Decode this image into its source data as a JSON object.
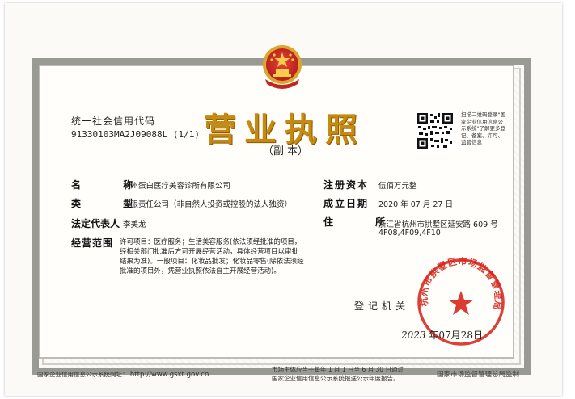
{
  "document": {
    "title": "营业执照",
    "subtitle": "（副 本）",
    "credit_code_label": "统一社会信用代码",
    "credit_code": "91330103MA2J09088L (1/1)",
    "qr_caption": "扫描二维码登录\"国家企业信用信息公示系统\"了解更多登记、备案、许可、监管信息",
    "fields": {
      "name_label": "名 称",
      "name": "杭州蛋白医疗美容诊所有限公司",
      "type_label": "类 型",
      "type": "有限责任公司（非自然人投资或控股的法人独资）",
      "legal_rep_label": "法定代表人",
      "legal_rep": "李美龙",
      "scope_label": "经营范围",
      "scope": "许可项目：医疗服务；生活美容服务(依法须经批准的项目，经相关部门批准后方可开展经营活动，具体经营项目以审批结果为准)。一般项目：化妆品批发；化妆品零售(除依法须经批准的项目外，凭营业执照依法自主开展经营活动)。",
      "capital_label": "注册资本",
      "capital": "伍佰万元整",
      "established_label": "成立日期",
      "established": "2020 年 07 月 27 日",
      "address_label": "住 所",
      "address_line1": "浙江省杭州市拱墅区延安路 609 号",
      "address_line2": "4F08,4F09,4F10"
    },
    "authority_label": "登记机关",
    "issue_date": {
      "year": "2023",
      "y_unit": "年",
      "month": "07",
      "m_unit": "月",
      "day": "28",
      "d_unit": "日"
    },
    "seal_text": "杭州市拱墅区市场监督管理局",
    "footer": {
      "left": "国家企业信用信息公示系统网址：",
      "url": "http://www.gsxt.gov.cn",
      "middle_line1": "市场主体应当于每年 1 月 1 日至 6 月 30 日通过",
      "middle_line2": "国家企业信用信息公示系统报送公示年度报告。",
      "right": "国家市场监督管理总局监制"
    }
  }
}
